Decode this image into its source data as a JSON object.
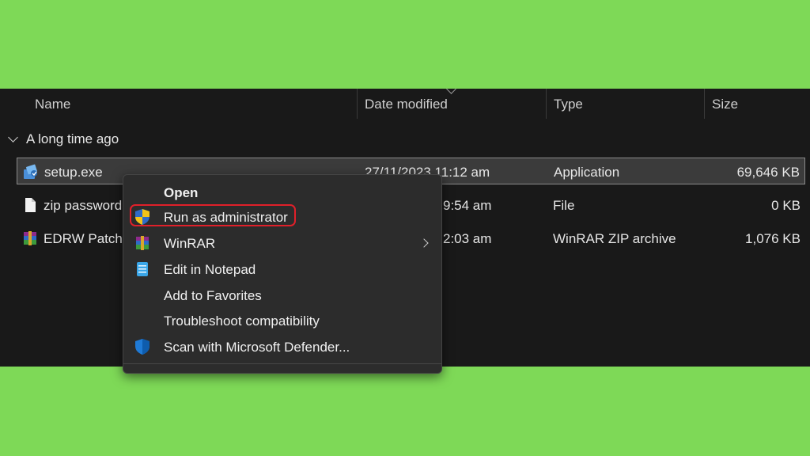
{
  "columns": {
    "name": "Name",
    "date": "Date modified",
    "type": "Type",
    "size": "Size"
  },
  "group": {
    "label": "A long time ago"
  },
  "files": [
    {
      "name": "setup.exe",
      "date": "27/11/2023 11:12 am",
      "type": "Application",
      "size": "69,646 KB",
      "icon": "installer-icon"
    },
    {
      "name": "zip password",
      "date": "9:54 am",
      "type": "File",
      "size": "0 KB",
      "icon": "file-icon"
    },
    {
      "name": "EDRW Patch",
      "date": "2:03 am",
      "type": "WinRAR ZIP archive",
      "size": "1,076 KB",
      "icon": "winrar-icon"
    }
  ],
  "context_menu": {
    "items": [
      {
        "label": "Open",
        "icon": ""
      },
      {
        "label": "Run as administrator",
        "icon": "uac-shield-icon"
      },
      {
        "label": "WinRAR",
        "icon": "winrar-icon"
      },
      {
        "label": "Edit in Notepad",
        "icon": "notepad-icon"
      },
      {
        "label": "Add to Favorites",
        "icon": ""
      },
      {
        "label": "Troubleshoot compatibility",
        "icon": ""
      },
      {
        "label": "Scan with Microsoft Defender...",
        "icon": "defender-shield-icon"
      }
    ]
  },
  "colors": {
    "background_green": "#7ed957",
    "explorer_bg": "#191919",
    "highlight_red": "#e0202a"
  }
}
